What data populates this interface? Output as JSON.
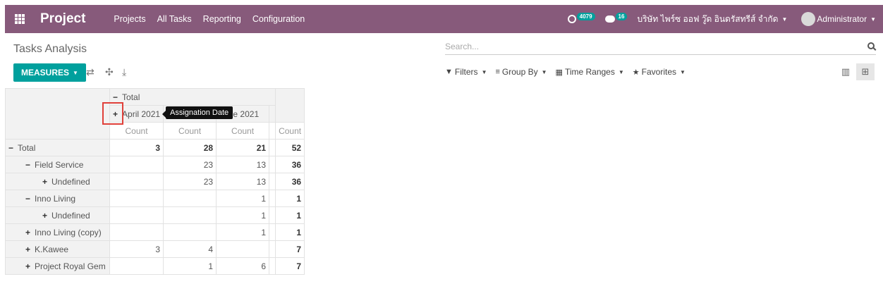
{
  "navbar": {
    "brand": "Project",
    "menu": [
      "Projects",
      "All Tasks",
      "Reporting",
      "Configuration"
    ],
    "activity_count": "4079",
    "message_count": "16",
    "company": "บริษัท ไพร์ซ ออฟ วู๊ด อินดรัสทรีส์ จำกัด",
    "user": "Administrator"
  },
  "control": {
    "breadcrumb": "Tasks Analysis",
    "search_placeholder": "Search...",
    "measures_label": "MEASURES",
    "filters_label": "Filters",
    "groupby_label": "Group By",
    "timeranges_label": "Time Ranges",
    "favorites_label": "Favorites"
  },
  "pivot": {
    "col_total_label": "Total",
    "columns": [
      "April 2021",
      "",
      "June 2021",
      ""
    ],
    "tooltip": "Assignation Date",
    "measure_label": "Count",
    "rows": [
      {
        "label": "Total",
        "sign": "−",
        "values": [
          "3",
          "28",
          "21"
        ],
        "total": "52",
        "level": 0
      },
      {
        "label": "Field Service",
        "sign": "−",
        "values": [
          "",
          "23",
          "13"
        ],
        "total": "36",
        "level": 1
      },
      {
        "label": "Undefined",
        "sign": "+",
        "values": [
          "",
          "23",
          "13"
        ],
        "total": "36",
        "level": 2
      },
      {
        "label": "Inno Living",
        "sign": "−",
        "values": [
          "",
          "",
          "1"
        ],
        "total": "1",
        "level": 1
      },
      {
        "label": "Undefined",
        "sign": "+",
        "values": [
          "",
          "",
          "1"
        ],
        "total": "1",
        "level": 2
      },
      {
        "label": "Inno Living (copy)",
        "sign": "+",
        "values": [
          "",
          "",
          "1"
        ],
        "total": "1",
        "level": 1
      },
      {
        "label": "K.Kawee",
        "sign": "+",
        "values": [
          "3",
          "4",
          ""
        ],
        "total": "7",
        "level": 1
      },
      {
        "label": "Project Royal Gem",
        "sign": "+",
        "values": [
          "",
          "1",
          "6"
        ],
        "total": "7",
        "level": 1
      }
    ]
  }
}
